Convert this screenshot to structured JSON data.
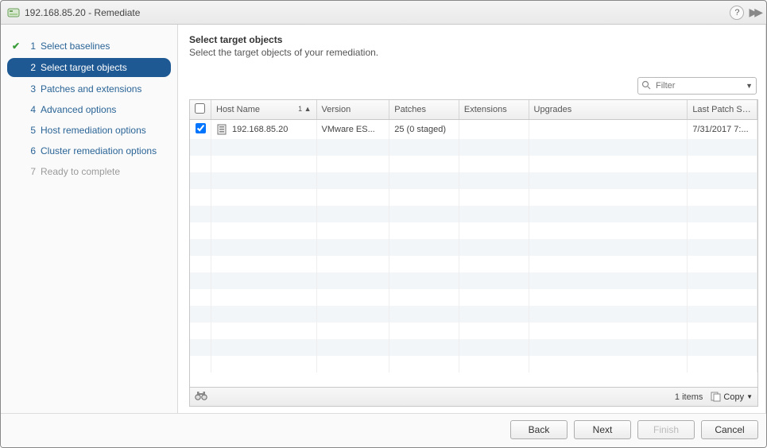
{
  "window": {
    "title": "192.168.85.20 - Remediate"
  },
  "wizard": {
    "steps": [
      {
        "num": "1",
        "label": "Select baselines",
        "done": true
      },
      {
        "num": "2",
        "label": "Select target objects",
        "active": true
      },
      {
        "num": "3",
        "label": "Patches and extensions"
      },
      {
        "num": "4",
        "label": "Advanced options"
      },
      {
        "num": "5",
        "label": "Host remediation options"
      },
      {
        "num": "6",
        "label": "Cluster remediation options"
      },
      {
        "num": "7",
        "label": "Ready to complete",
        "disabled": true
      }
    ]
  },
  "panel": {
    "heading": "Select target objects",
    "description": "Select the target objects of your remediation."
  },
  "filter": {
    "placeholder": "Filter"
  },
  "grid": {
    "columns": {
      "hostname": "Host Name",
      "version": "Version",
      "patches": "Patches",
      "extensions": "Extensions",
      "upgrades": "Upgrades",
      "lastscan": "Last Patch Scan..."
    },
    "sort_indicator": "1 ▲",
    "rows": [
      {
        "checked": true,
        "hostname": "192.168.85.20",
        "version": "VMware ES...",
        "patches": "25 (0 staged)",
        "extensions": "",
        "upgrades": "",
        "lastscan": "7/31/2017 7:..."
      }
    ],
    "blank_rows": 14,
    "footer_count": "1 items",
    "copy_label": "Copy"
  },
  "buttons": {
    "back": "Back",
    "next": "Next",
    "finish": "Finish",
    "cancel": "Cancel"
  }
}
